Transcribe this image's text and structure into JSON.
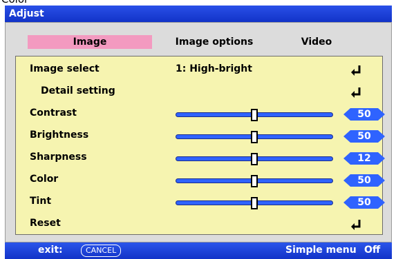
{
  "top_label": "Color",
  "window": {
    "title": "Adjust"
  },
  "tabs": [
    {
      "label": "Image",
      "active": true
    },
    {
      "label": "Image options",
      "active": false
    },
    {
      "label": "Video",
      "active": false
    }
  ],
  "rows": {
    "image_select": {
      "label": "Image select",
      "value": "1: High-bright",
      "icon": "enter-arrow-icon"
    },
    "detail_setting": {
      "label": "Detail setting",
      "icon": "enter-arrow-icon"
    },
    "contrast": {
      "label": "Contrast",
      "value": "50",
      "level": 0.5
    },
    "brightness": {
      "label": "Brightness",
      "value": "50",
      "level": 0.5
    },
    "sharpness": {
      "label": "Sharpness",
      "value": "12",
      "level": 0.5
    },
    "color": {
      "label": "Color",
      "value": "50",
      "level": 0.5
    },
    "tint": {
      "label": "Tint",
      "value": "50",
      "level": 0.5
    },
    "reset": {
      "label": "Reset",
      "icon": "enter-arrow-icon"
    }
  },
  "status": {
    "exit_label": "exit:",
    "cancel_key": "CANCEL",
    "simple_menu_label": "Simple menu",
    "simple_menu_value": "Off"
  },
  "colors": {
    "title_blue": "#1f44dc",
    "content_bg": "#f6f4b0",
    "active_tab": "#f39ac0",
    "slider_blue": "#2f63ff"
  }
}
